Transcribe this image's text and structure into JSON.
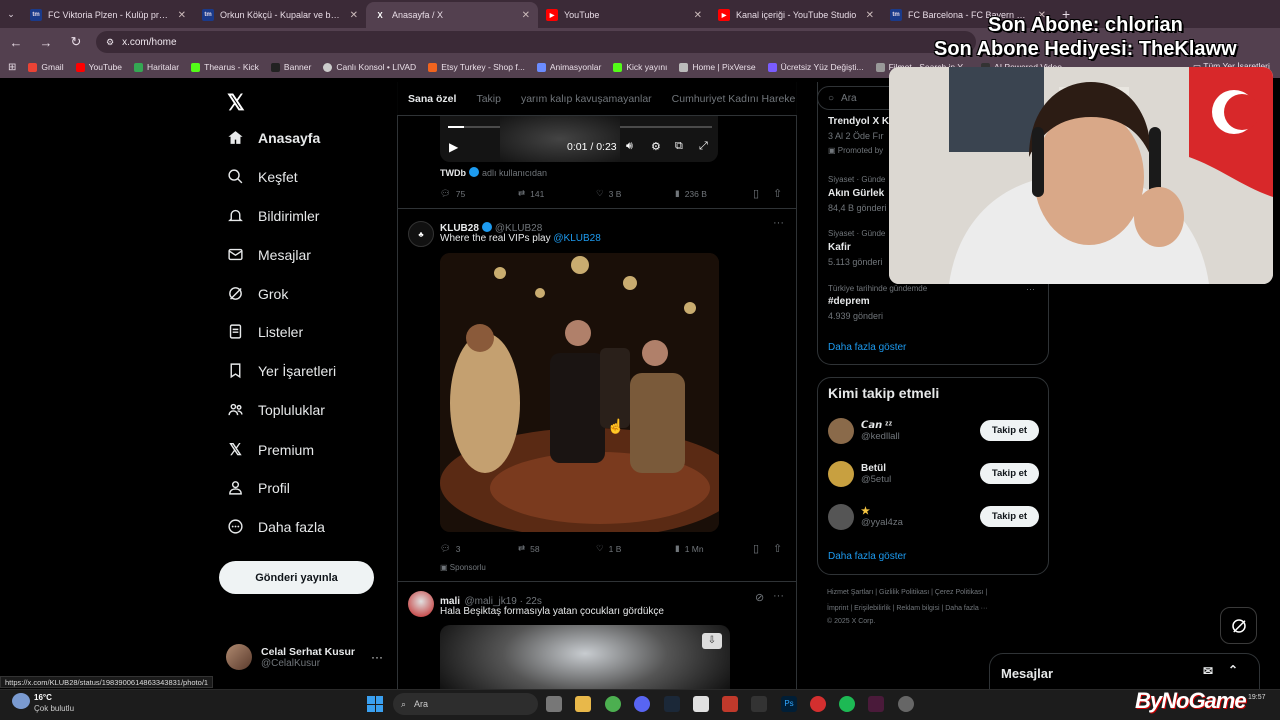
{
  "browser": {
    "tabs": [
      {
        "label": "FC Viktoria Plzen - Kulüp profili",
        "fav": "tm",
        "fav_color": "#1a3a8a"
      },
      {
        "label": "Orkun Kökçü - Kupalar ve başarı",
        "fav": "tm",
        "fav_color": "#1a3a8a"
      },
      {
        "label": "Anasayfa / X",
        "fav": "X",
        "fav_color": "#000000"
      },
      {
        "label": "YouTube",
        "fav": "▶",
        "fav_color": "#ff0000"
      },
      {
        "label": "Kanal içeriği - YouTube Studio",
        "fav": "▶",
        "fav_color": "#ff0000"
      },
      {
        "label": "FC Barcelona - FC Bayern Mün",
        "fav": "tm",
        "fav_color": "#1a3a8a"
      }
    ],
    "url": "x.com/home",
    "bookmarks": [
      "Gmail",
      "YouTube",
      "Haritalar",
      "Thearus - Kick",
      "Banner",
      "Canlı Konsol • LIVAD",
      "Etsy Turkey - Shop f...",
      "Animasyonlar",
      "Kick yayını",
      "Home | PixVerse",
      "Ücretsiz Yüz Değişti...",
      "Filmot - Search in Y...",
      "AI Powered Video"
    ],
    "bookmarks_all": "Tüm Yer İşaretleri",
    "status_url": "https://x.com/KLUB28/status/1983900614863343831/photo/1"
  },
  "nav": {
    "home": "Anasayfa",
    "explore": "Keşfet",
    "notifications": "Bildirimler",
    "messages": "Mesajlar",
    "grok": "Grok",
    "lists": "Listeler",
    "bookmarks": "Yer İşaretleri",
    "communities": "Topluluklar",
    "premium": "Premium",
    "profile": "Profil",
    "more": "Daha fazla",
    "post_button": "Gönderi yayınla",
    "user_name": "Celal Serhat Kusur",
    "user_handle": "@CelalKusur"
  },
  "feed": {
    "tabs": [
      "Sana özel",
      "Takip",
      "yarım kalıp kavuşamayanlar",
      "Cumhuriyet Kadını Hareke"
    ],
    "video_time": "0:01 / 0:23",
    "post1": {
      "source": "TWDb",
      "source_suffix": "adlı kullanıcıdan",
      "replies": "75",
      "reposts": "141",
      "likes": "3 B",
      "views": "236 B"
    },
    "post2": {
      "name": "KLUB28",
      "handle": "@KLUB28",
      "text": "Where the real VIPs play",
      "mention": "@KLUB28",
      "replies": "3",
      "reposts": "58",
      "likes": "1 B",
      "views": "1 Mn",
      "promoted": "Sponsorlu"
    },
    "post3": {
      "name": "mali",
      "handle": "@mali_jk19 · 22s",
      "text": "Hala Beşiktaş formasıyla yatan çocukları gördükçe"
    }
  },
  "right": {
    "search_placeholder": "Ara",
    "trends": [
      {
        "meta": "",
        "title": "Trendyol X Ki",
        "sub": "3 Al 2 Öde Fır",
        "promo": "Promoted by"
      },
      {
        "meta": "Siyaset · Günde",
        "title": "Akın Gürlek",
        "sub": "84,4 B gönderi"
      },
      {
        "meta": "Siyaset · Günde",
        "title": "Kafir",
        "sub": "5.113 gönderi"
      },
      {
        "meta": "Türkiye tarihinde gündemde",
        "title": "#deprem",
        "sub": "4.939 gönderi"
      }
    ],
    "trends_more": "Daha fazla göster",
    "who_title": "Kimi takip etmeli",
    "who": [
      {
        "name": "𝘾𝙖𝙣 ᶻᶻ",
        "handle": "@kedllall",
        "btn": "Takip et",
        "avatar_color": "#8a6a4a"
      },
      {
        "name": "Betül",
        "handle": "@5etul",
        "btn": "Takip et",
        "avatar_color": "#c8a040"
      },
      {
        "name": "★",
        "handle": "@yyal4za",
        "btn": "Takip et",
        "avatar_color": "#555555"
      }
    ],
    "who_more": "Daha fazla göster",
    "footer1": "Hizmet Şartları  |  Gizlilik Politikası  |  Çerez Politikası  |",
    "footer2": "İmprint  |  Erişilebilirlik  |  Reklam bilgisi  |  Daha fazla ···",
    "footer3": "© 2025 X Corp."
  },
  "overlay": {
    "line1": "Son Abone: chlorian",
    "line2": "Son Abone Hediyesi: TheKlaww",
    "messages": "Mesajlar",
    "brand": "ByNoGame"
  },
  "taskbar": {
    "temp": "16°C",
    "weather": "Çok bulutlu",
    "search": "Ara",
    "time": "19:57"
  }
}
